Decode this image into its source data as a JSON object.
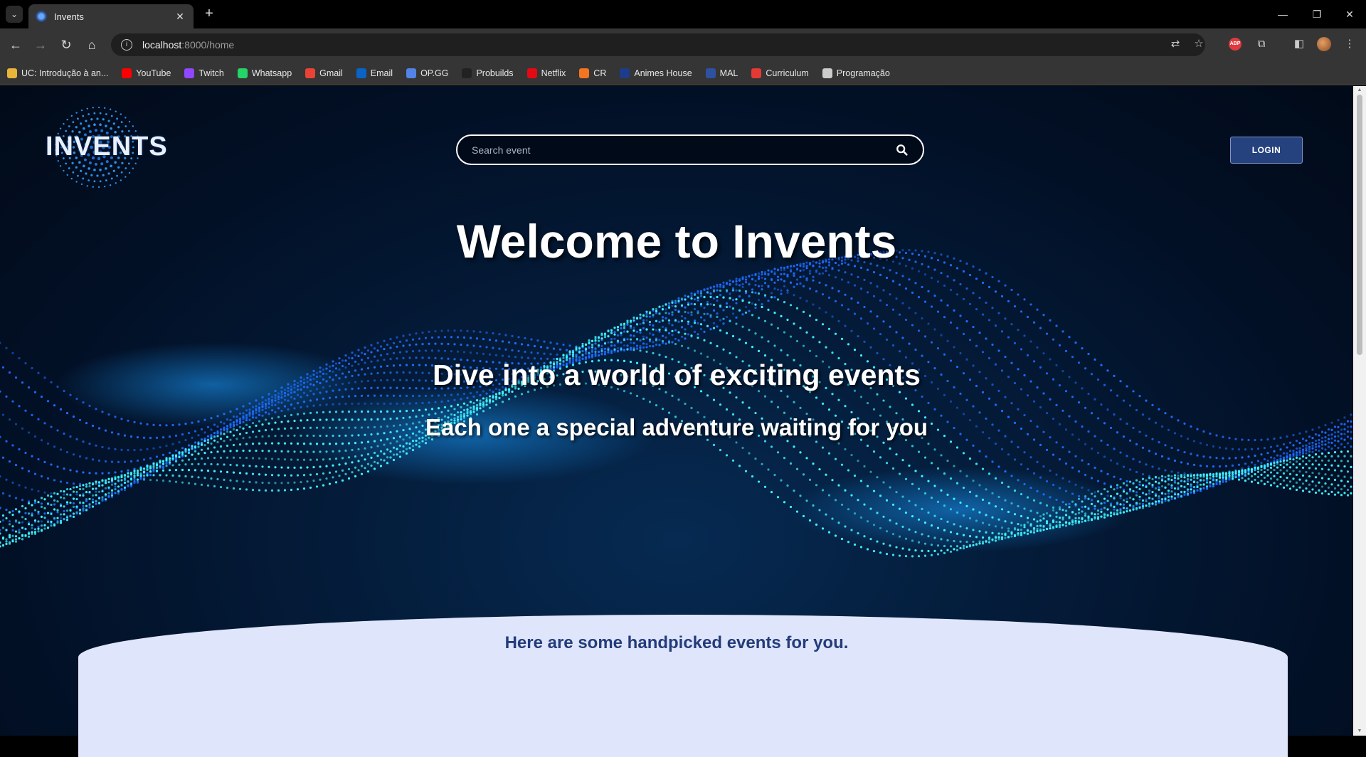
{
  "browser": {
    "tab_title": "Invents",
    "url_host": "localhost",
    "url_path": ":8000/home",
    "bookmarks": [
      {
        "label": "UC: Introdução à an...",
        "icon": "uc-icon",
        "color": "#e8b43a"
      },
      {
        "label": "YouTube",
        "icon": "youtube-icon",
        "color": "#ff0000"
      },
      {
        "label": "Twitch",
        "icon": "twitch-icon",
        "color": "#9146ff"
      },
      {
        "label": "Whatsapp",
        "icon": "whatsapp-icon",
        "color": "#25d366"
      },
      {
        "label": "Gmail",
        "icon": "gmail-icon",
        "color": "#ea4335"
      },
      {
        "label": "Email",
        "icon": "outlook-icon",
        "color": "#0a64c8"
      },
      {
        "label": "OP.GG",
        "icon": "opgg-icon",
        "color": "#5383e8"
      },
      {
        "label": "Probuilds",
        "icon": "probuilds-icon",
        "color": "#222222"
      },
      {
        "label": "Netflix",
        "icon": "netflix-icon",
        "color": "#e50914"
      },
      {
        "label": "CR",
        "icon": "cr-icon",
        "color": "#f47521"
      },
      {
        "label": "Animes House",
        "icon": "animes-house-icon",
        "color": "#1e3c8c"
      },
      {
        "label": "MAL",
        "icon": "mal-icon",
        "color": "#2e51a2"
      },
      {
        "label": "Curriculum",
        "icon": "curriculum-icon",
        "color": "#e53935"
      },
      {
        "label": "Programação",
        "icon": "folder-icon",
        "color": "#cccccc"
      }
    ]
  },
  "header": {
    "logo_text": "INVENTS",
    "search_placeholder": "Search event",
    "login_label": "LOGIN"
  },
  "hero": {
    "title": "Welcome to Invents",
    "subtitle": "Dive into a world of exciting events",
    "tagline": "Each one a special adventure waiting for you"
  },
  "featured": {
    "title": "Here are some handpicked events for you."
  },
  "colors": {
    "login_bg": "#26427e",
    "panel_bg": "#dfe5fb",
    "panel_title": "#233c7a",
    "wave_cyan": "#3ff3ff",
    "wave_blue": "#1e6bff"
  }
}
